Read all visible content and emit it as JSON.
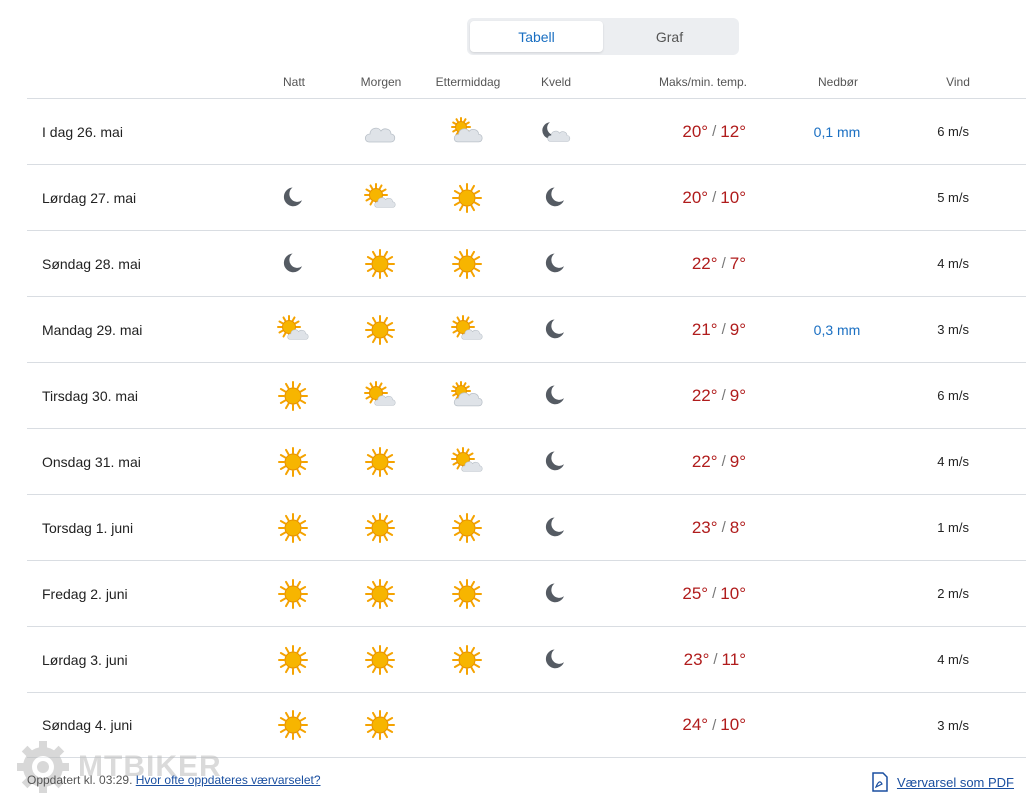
{
  "tabs": {
    "table": "Tabell",
    "graph": "Graf"
  },
  "headers": {
    "night": "Natt",
    "morning": "Morgen",
    "afternoon": "Ettermiddag",
    "evening": "Kveld",
    "temp": "Maks/min. temp.",
    "precip": "Nedbør",
    "wind": "Vind"
  },
  "rows": [
    {
      "day": "I dag 26. mai",
      "night": "",
      "morning": "cloudy-icon",
      "afternoon": "partly-cloudy-day-icon",
      "evening": "partly-cloudy-night-icon",
      "max": "20°",
      "min": "12°",
      "precip": "0,1 mm",
      "wind": "6 m/s"
    },
    {
      "day": "Lørdag 27. mai",
      "night": "moon-icon",
      "morning": "fair-day-icon",
      "afternoon": "sun-icon",
      "evening": "moon-icon",
      "max": "20°",
      "min": "10°",
      "precip": "",
      "wind": "5 m/s"
    },
    {
      "day": "Søndag 28. mai",
      "night": "moon-icon",
      "morning": "sun-icon",
      "afternoon": "sun-icon",
      "evening": "moon-icon",
      "max": "22°",
      "min": "7°",
      "precip": "",
      "wind": "4 m/s"
    },
    {
      "day": "Mandag 29. mai",
      "night": "fair-day-icon",
      "morning": "sun-icon",
      "afternoon": "fair-day-icon",
      "evening": "moon-icon",
      "max": "21°",
      "min": "9°",
      "precip": "0,3 mm",
      "wind": "3 m/s"
    },
    {
      "day": "Tirsdag 30. mai",
      "night": "sun-icon",
      "morning": "fair-day-icon",
      "afternoon": "partly-cloudy-day-icon",
      "evening": "moon-icon",
      "max": "22°",
      "min": "9°",
      "precip": "",
      "wind": "6 m/s"
    },
    {
      "day": "Onsdag 31. mai",
      "night": "sun-icon",
      "morning": "sun-icon",
      "afternoon": "fair-day-icon",
      "evening": "moon-icon",
      "max": "22°",
      "min": "9°",
      "precip": "",
      "wind": "4 m/s"
    },
    {
      "day": "Torsdag 1. juni",
      "night": "sun-icon",
      "morning": "sun-icon",
      "afternoon": "sun-icon",
      "evening": "moon-icon",
      "max": "23°",
      "min": "8°",
      "precip": "",
      "wind": "1 m/s"
    },
    {
      "day": "Fredag 2. juni",
      "night": "sun-icon",
      "morning": "sun-icon",
      "afternoon": "sun-icon",
      "evening": "moon-icon",
      "max": "25°",
      "min": "10°",
      "precip": "",
      "wind": "2 m/s"
    },
    {
      "day": "Lørdag 3. juni",
      "night": "sun-icon",
      "morning": "sun-icon",
      "afternoon": "sun-icon",
      "evening": "moon-icon",
      "max": "23°",
      "min": "11°",
      "precip": "",
      "wind": "4 m/s"
    },
    {
      "day": "Søndag 4. juni",
      "night": "sun-icon",
      "morning": "sun-icon",
      "afternoon": "",
      "evening": "",
      "max": "24°",
      "min": "10°",
      "precip": "",
      "wind": "3 m/s"
    }
  ],
  "temp_separator": "/",
  "footer": {
    "updated": "Oppdatert kl. 03:29.",
    "how_often_link": "Hvor ofte oppdateres værvarselet?",
    "pdf_link": "Værvarsel som PDF"
  },
  "watermark": "MTBIKER",
  "colors": {
    "accent": "#1a6fc2",
    "temp": "#b01c1c",
    "sun": "#f5a300",
    "moon": "#555b63",
    "cloud": "#d6dbe0"
  }
}
